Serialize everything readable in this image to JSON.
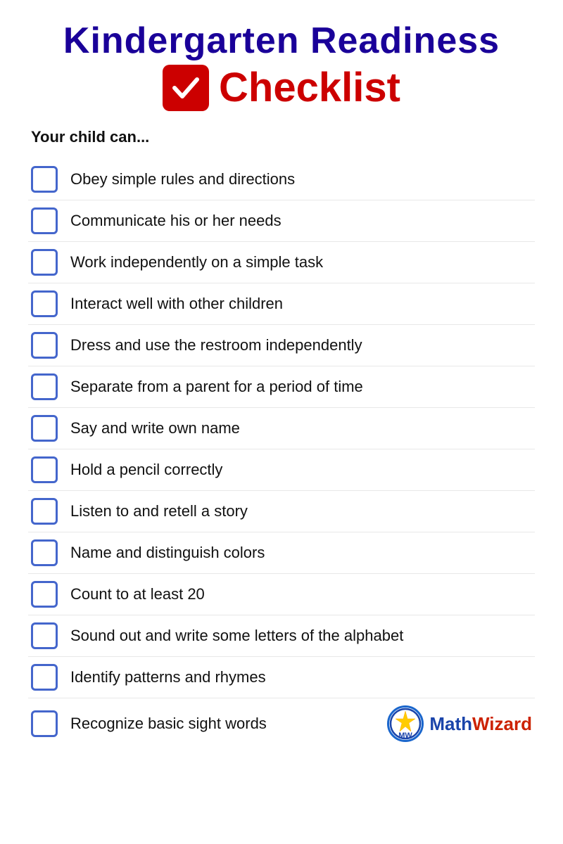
{
  "header": {
    "line1": "Kindergarten Readiness",
    "line2_word": "Checklist"
  },
  "subtitle": "Your child can...",
  "items": [
    {
      "id": 1,
      "text": "Obey simple rules and directions"
    },
    {
      "id": 2,
      "text": "Communicate his or her needs"
    },
    {
      "id": 3,
      "text": "Work independently on a simple task"
    },
    {
      "id": 4,
      "text": "Interact well with other children"
    },
    {
      "id": 5,
      "text": "Dress and use the restroom independently"
    },
    {
      "id": 6,
      "text": "Separate from a parent for a period of time"
    },
    {
      "id": 7,
      "text": "Say and write own name"
    },
    {
      "id": 8,
      "text": "Hold a pencil correctly"
    },
    {
      "id": 9,
      "text": "Listen to and retell a story"
    },
    {
      "id": 10,
      "text": "Name and distinguish colors"
    },
    {
      "id": 11,
      "text": "Count to at least 20"
    },
    {
      "id": 12,
      "text": "Sound out and write some letters of the alphabet"
    },
    {
      "id": 13,
      "text": "Identify patterns and rhymes"
    },
    {
      "id": 14,
      "text": "Recognize basic sight words"
    }
  ],
  "brand": {
    "name": "MathWizard",
    "math_part": "Math",
    "wizard_part": "Wizard"
  }
}
